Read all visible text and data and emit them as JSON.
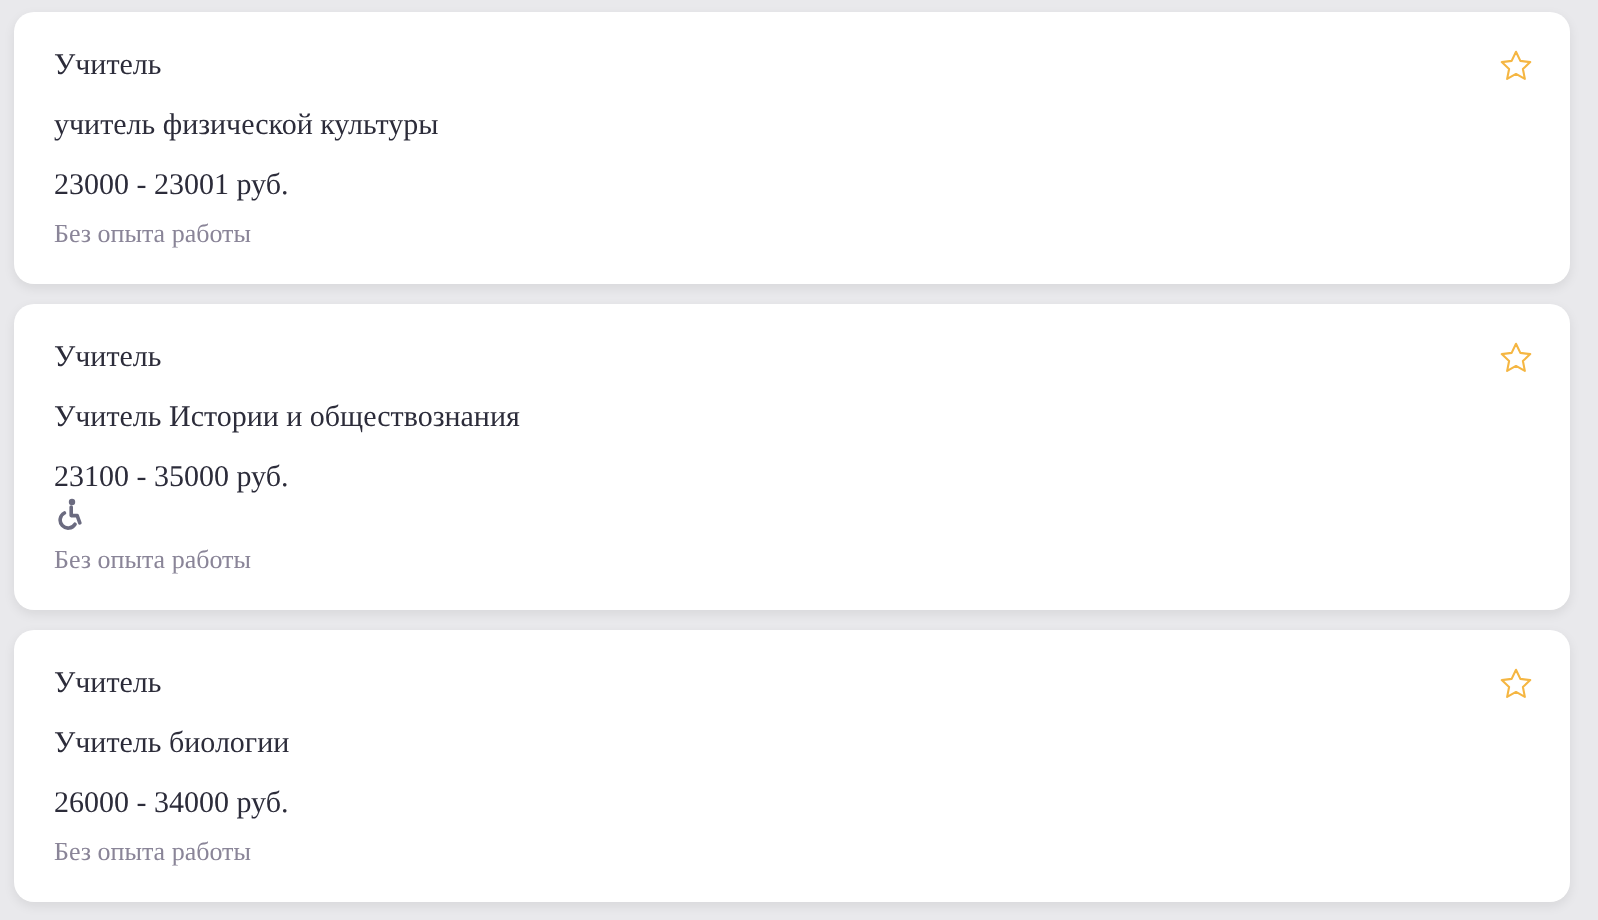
{
  "vacancies": [
    {
      "category": "Учитель",
      "position": "учитель физической культуры",
      "salary": "23000 - 23001 руб.",
      "accessible": false,
      "experience": "Без опыта работы",
      "favorite": false
    },
    {
      "category": "Учитель",
      "position": "Учитель Истории и обществознания",
      "salary": "23100 - 35000 руб.",
      "accessible": true,
      "experience": "Без опыта работы",
      "favorite": false
    },
    {
      "category": "Учитель",
      "position": "Учитель биологии",
      "salary": "26000 - 34000 руб.",
      "accessible": false,
      "experience": "Без опыта работы",
      "favorite": false
    }
  ]
}
